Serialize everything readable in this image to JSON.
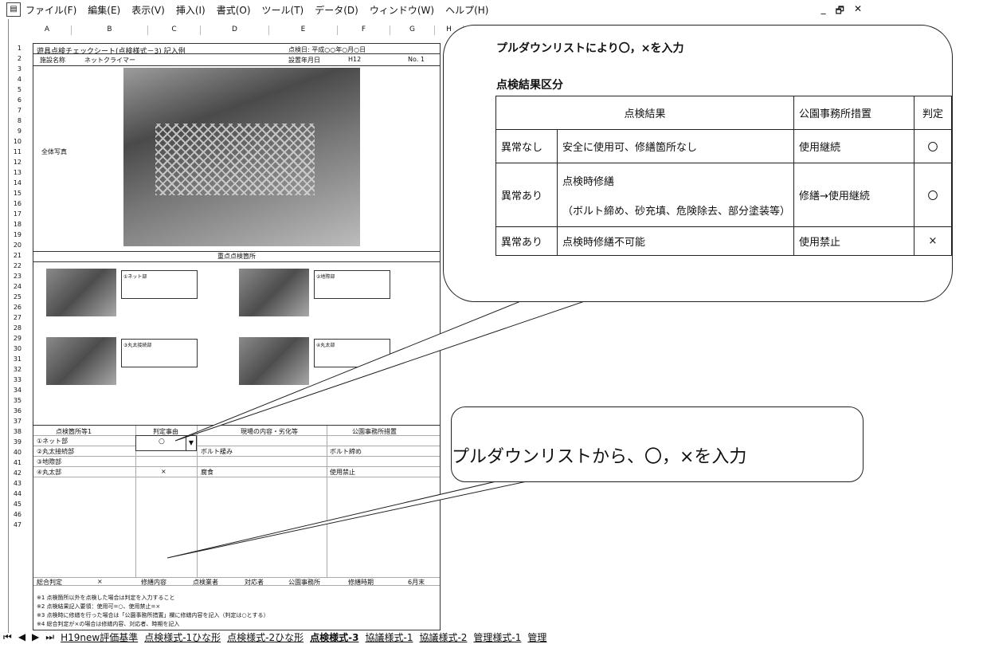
{
  "menu": {
    "items": [
      "ファイル(F)",
      "編集(E)",
      "表示(V)",
      "挿入(I)",
      "書式(O)",
      "ツール(T)",
      "データ(D)",
      "ウィンドウ(W)",
      "ヘルプ(H)"
    ],
    "window_controls": [
      "_",
      "🗗",
      "✕"
    ]
  },
  "sheet": {
    "columns": [
      "A",
      "B",
      "C",
      "D",
      "E",
      "F",
      "G",
      "H"
    ],
    "rows": [
      "1",
      "2",
      "3",
      "4",
      "5",
      "6",
      "7",
      "8",
      "9",
      "10",
      "11",
      "12",
      "13",
      "14",
      "15",
      "16",
      "17",
      "18",
      "19",
      "20",
      "21",
      "22",
      "23",
      "24",
      "25",
      "26",
      "27",
      "28",
      "29",
      "30",
      "31",
      "32",
      "33",
      "34",
      "35",
      "36",
      "37",
      "38",
      "39",
      "40",
      "41",
      "42",
      "43",
      "44",
      "45",
      "46",
      "47"
    ],
    "form": {
      "title": "遊具点検チェックシート(点検様式－3)  記入例",
      "date": "点検日: 平成○○年○月○日",
      "facility_label": "施設名称",
      "facility_value": "ネットクライマー",
      "install_label": "設置年月日",
      "install_value": "H12",
      "no": "No. 1",
      "whole_photo_label": "全体写真",
      "section_header": "重点点検箇所",
      "notes_boxes": [
        "①ネット部",
        "②地際部",
        "③丸太接続部",
        "④丸太部"
      ],
      "table_headers": [
        "点検箇所等1",
        "判定事由",
        "現場の内容・劣化等",
        "公園事務所措置"
      ],
      "table_rows": [
        {
          "item": "①ネット部",
          "judge": "○",
          "detail": "",
          "action": ""
        },
        {
          "item": "②丸太接続部",
          "judge": "",
          "detail": "ボルト緩み",
          "action": "ボルト締め"
        },
        {
          "item": "③地際部",
          "judge": "",
          "detail": "",
          "action": ""
        },
        {
          "item": "④丸太部",
          "judge": "×",
          "detail": "腐食",
          "action": "使用禁止"
        }
      ],
      "footer_headers": [
        "総合判定",
        "×",
        "修繕内容",
        "点検業者",
        "対応者",
        "公園事務所",
        "修繕時期",
        "6月末"
      ],
      "footnotes": [
        "※1 点検箇所以外を点検した場合は判定を入力すること",
        "※2 点検結果記入要領：使用可=○、使用禁止=×",
        "※3 点検時に修繕を行った場合は「公園事務所措置」欄に修繕内容を記入（判定は○とする）",
        "※4 総合判定が×の場合は修繕内容、対応者、時期を記入"
      ],
      "dropdown_value": "○"
    }
  },
  "tabs": {
    "nav": [
      "⏮",
      "◀",
      "▶",
      "⏭"
    ],
    "items": [
      "H19new評価基準",
      "点検様式-1ひな形",
      "点検様式-2ひな形",
      "点検様式-3",
      "協議様式-1",
      "協議様式-2",
      "管理様式-1",
      "管理"
    ]
  },
  "callout_top": {
    "line1": "プルダウンリストにより〇，×を入力",
    "line2": "点検結果区分",
    "table": {
      "headers": [
        "点検結果",
        "公園事務所措置",
        "判定"
      ],
      "rows": [
        {
          "status": "異常なし",
          "desc": "安全に使用可、修繕箇所なし",
          "action": "使用継続",
          "judge": "〇"
        },
        {
          "status": "異常あり",
          "desc": "点検時修繕",
          "desc2": "（ボルト締め、砂充填、危険除去、部分塗装等）",
          "action": "修繕→使用継続",
          "judge": "〇"
        },
        {
          "status": "異常あり",
          "desc": "点検時修繕不可能",
          "action": "使用禁止",
          "judge": "×"
        }
      ]
    }
  },
  "callout_bottom": {
    "text": "プルダウンリストから、〇，×を入力"
  }
}
